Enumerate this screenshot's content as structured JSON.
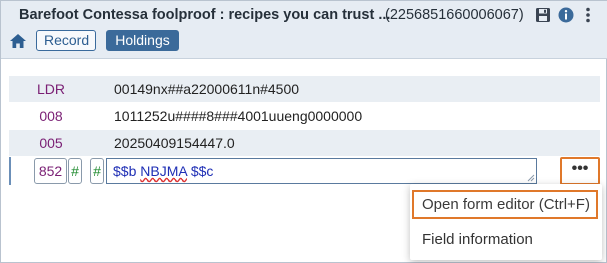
{
  "header": {
    "title": "Barefoot Contessa foolproof : recipes you can trust ...",
    "record_id": "(2256851660006067)",
    "icons": [
      "save-icon",
      "info-icon",
      "more-vertical-icon",
      "home-icon"
    ]
  },
  "tabs": {
    "record": "Record",
    "holdings": "Holdings"
  },
  "fields": [
    {
      "tag": "LDR",
      "value": "00149nx##a22000611n#4500"
    },
    {
      "tag": "008",
      "value": "1011252u####8###4001uueng0000000"
    },
    {
      "tag": "005",
      "value": "20250409154447.0"
    }
  ],
  "edit_field": {
    "tag": "852",
    "ind1": "#",
    "ind2": "#",
    "subfield_b_code": "$$b",
    "subfield_b_value": "NBJMA",
    "subfield_c_code": "$$c",
    "more_label": "•••"
  },
  "menu": {
    "open_form_editor": "Open form editor (Ctrl+F)",
    "field_information": "Field information"
  },
  "colors": {
    "accent": "#e0782a",
    "tag_color": "#7a1f74",
    "indicator_color": "#1e8a2e",
    "subfield_color": "#1f2fb5",
    "header_bg": "#e6ecf3",
    "tab_active": "#3b6a9a"
  }
}
